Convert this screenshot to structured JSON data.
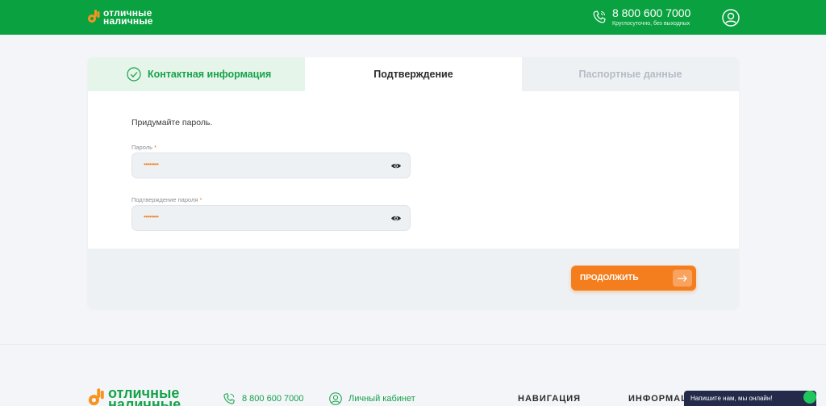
{
  "header": {
    "logo_line1": "отличные",
    "logo_line2": "наличные",
    "phone": "8 800 600 7000",
    "phone_note": "Круглосуточно, без выходных"
  },
  "tabs": [
    {
      "label": "Контактная информация",
      "state": "done"
    },
    {
      "label": "Подтверждение",
      "state": "active"
    },
    {
      "label": "Паспортные данные",
      "state": "upcoming"
    }
  ],
  "form": {
    "prompt": "Придумайте пароль.",
    "password": {
      "label": "Пароль",
      "required_mark": "*",
      "value": "••••••••"
    },
    "password_confirm": {
      "label": "Подтверждение пароля",
      "required_mark": "*",
      "value": "••••••••"
    }
  },
  "actions": {
    "continue_label": "ПРОДОЛЖИТЬ"
  },
  "footer": {
    "logo_line1": "отличные",
    "logo_line2": "наличные",
    "phone": "8 800 600 7000",
    "cabinet": "Личный кабинет",
    "nav_heading": "НАВИГАЦИЯ",
    "info_heading": "ИНФОРМАЦ"
  },
  "chat": {
    "label": "Напишите нам, мы онлайн!"
  },
  "colors": {
    "brand_green": "#0aa240",
    "accent_orange": "#f47e1d",
    "chat_navy": "#232a4a"
  }
}
